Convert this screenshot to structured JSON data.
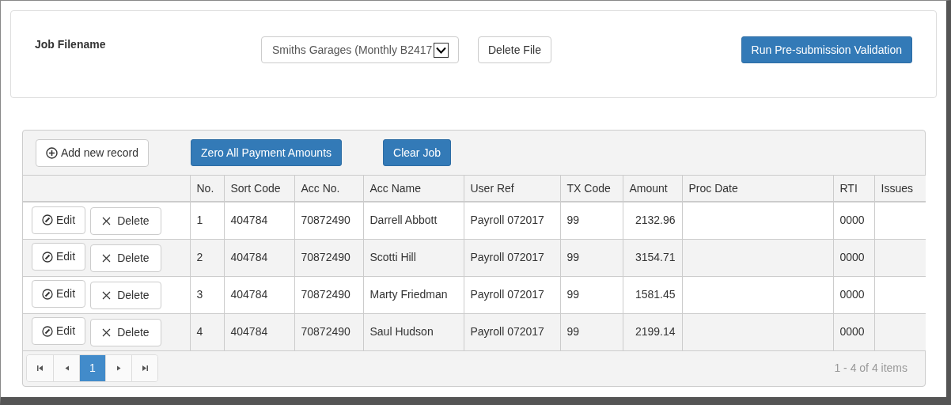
{
  "job_panel": {
    "label": "Job Filename",
    "file_select": {
      "value": "Smiths Garages (Monthly B2417"
    },
    "delete_button": "Delete File",
    "validate_button": "Run Pre-submission Validation"
  },
  "grid": {
    "toolbar": [
      {
        "kind": "outline",
        "label": "Add new record"
      },
      {
        "kind": "primary",
        "label": "Zero All Payment Amounts"
      },
      {
        "kind": "primary",
        "label": "Clear Job"
      }
    ],
    "columns": [
      "",
      "No.",
      "Sort Code",
      "Acc No.",
      "Acc Name",
      "User Ref",
      "TX Code",
      "Amount",
      "Proc Date",
      "RTI",
      "Issues"
    ],
    "rows": [
      {
        "actions": [
          "Edit",
          "Delete"
        ],
        "no": "1",
        "sort_code": "404784",
        "acc_no": "70872490",
        "acc_name": "Darrell Abbott",
        "user_ref": "Payroll 072017",
        "tx_code": "99",
        "amount": "2132.96",
        "rti": "0000"
      },
      {
        "actions": [
          "Edit",
          "Delete"
        ],
        "no": "2",
        "sort_code": "404784",
        "acc_no": "70872490",
        "acc_name": "Scotti Hill",
        "user_ref": "Payroll 072017",
        "tx_code": "99",
        "amount": "3154.71",
        "rti": "0000"
      },
      {
        "actions": [
          "Edit",
          "Delete"
        ],
        "no": "3",
        "sort_code": "404784",
        "acc_no": "70872490",
        "acc_name": "Marty Friedman",
        "user_ref": "Payroll 072017",
        "tx_code": "99",
        "amount": "1581.45",
        "rti": "0000"
      },
      {
        "actions": [
          "Edit",
          "Delete"
        ],
        "no": "4",
        "sort_code": "404784",
        "acc_no": "70872490",
        "acc_name": "Saul Hudson",
        "user_ref": "Payroll 072017",
        "tx_code": "99",
        "amount": "2199.14",
        "rti": "0000"
      }
    ],
    "pager": {
      "pages": [
        {
          "label": "1",
          "selected": true
        }
      ],
      "summary": "1 - 4 of 4 items"
    }
  }
}
